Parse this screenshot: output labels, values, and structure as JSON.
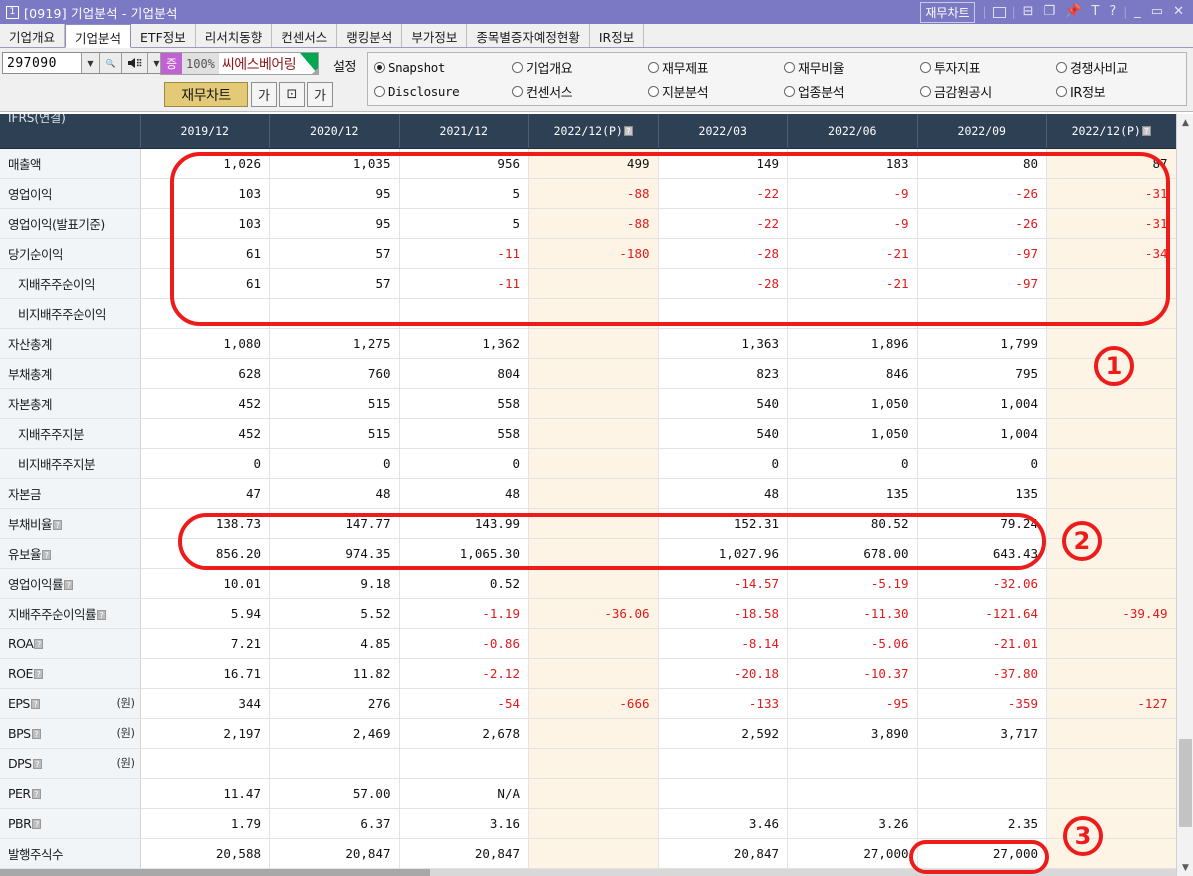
{
  "titlebar": {
    "window_number": "1",
    "title": "[0919] 기업분석 - 기업분석",
    "chart_button": "재무차트",
    "icons": [
      "line-chart-icon",
      "restore-icon",
      "cascade-icon",
      "pin-icon",
      "text-icon",
      "help-icon"
    ],
    "minimize": "_",
    "maximize": "▭",
    "close": "✕",
    "bg_color": "#7b79c4"
  },
  "tabs": [
    {
      "label": "기업개요",
      "active": false
    },
    {
      "label": "기업분석",
      "active": true
    },
    {
      "label": "ETF정보",
      "active": false
    },
    {
      "label": "리서치동향",
      "active": false
    },
    {
      "label": "컨센서스",
      "active": false
    },
    {
      "label": "랭킹분석",
      "active": false
    },
    {
      "label": "부가정보",
      "active": false
    },
    {
      "label": "종목별증자예정현황",
      "active": false
    },
    {
      "label": "IR정보",
      "active": false
    }
  ],
  "toolbar": {
    "code_value": "297090",
    "code_placeholder": "종목코드",
    "dropdown_icon": "chevron-down-icon",
    "search_icon": "search-icon",
    "speaker_icon": "speaker-icon",
    "stock_badge": "증",
    "stock_percent": "100%",
    "stock_name": "씨에스베어링",
    "setting_label": "설정",
    "chart_button": "재무차트",
    "font_small_button": "가",
    "fit_button": "⊡",
    "font_large_button": "가",
    "badge_color": "#c062d2",
    "name_color": "#8b1a1a",
    "chart_button_color": "#e3ca76"
  },
  "radios": {
    "row1": [
      {
        "label": "Snapshot",
        "selected": true,
        "mono": true
      },
      {
        "label": "기업개요",
        "selected": false,
        "mono": false
      },
      {
        "label": "재무제표",
        "selected": false,
        "mono": false
      },
      {
        "label": "재무비율",
        "selected": false,
        "mono": false
      },
      {
        "label": "투자지표",
        "selected": false,
        "mono": false
      },
      {
        "label": "경쟁사비교",
        "selected": false,
        "mono": false
      }
    ],
    "row2": [
      {
        "label": "Disclosure",
        "selected": false,
        "mono": true
      },
      {
        "label": "컨센서스",
        "selected": false,
        "mono": false
      },
      {
        "label": "지분분석",
        "selected": false,
        "mono": false
      },
      {
        "label": "업종분석",
        "selected": false,
        "mono": false
      },
      {
        "label": "금감원공시",
        "selected": false,
        "mono": false
      },
      {
        "label": "IR정보",
        "selected": false,
        "mono": false
      }
    ]
  },
  "table": {
    "corner_label": "IFRS(연결)",
    "columns": [
      {
        "label": "2019/12",
        "estimate": false
      },
      {
        "label": "2020/12",
        "estimate": false
      },
      {
        "label": "2021/12",
        "estimate": false
      },
      {
        "label": "2022/12(P)",
        "estimate": true
      },
      {
        "label": "2022/03",
        "estimate": false
      },
      {
        "label": "2022/06",
        "estimate": false
      },
      {
        "label": "2022/09",
        "estimate": false
      },
      {
        "label": "2022/12(P)",
        "estimate": true
      }
    ],
    "rows": [
      {
        "label": "매출액",
        "indent": false,
        "help": false,
        "unit": "",
        "values": [
          "1,026",
          "1,035",
          "956",
          "499",
          "149",
          "183",
          "80",
          "87"
        ]
      },
      {
        "label": "영업이익",
        "indent": false,
        "help": false,
        "unit": "",
        "values": [
          "103",
          "95",
          "5",
          "-88",
          "-22",
          "-9",
          "-26",
          "-31"
        ]
      },
      {
        "label": "영업이익(발표기준)",
        "indent": false,
        "help": false,
        "unit": "",
        "values": [
          "103",
          "95",
          "5",
          "-88",
          "-22",
          "-9",
          "-26",
          "-31"
        ]
      },
      {
        "label": "당기순이익",
        "indent": false,
        "help": false,
        "unit": "",
        "values": [
          "61",
          "57",
          "-11",
          "-180",
          "-28",
          "-21",
          "-97",
          "-34"
        ]
      },
      {
        "label": "지배주주순이익",
        "indent": true,
        "help": false,
        "unit": "",
        "values": [
          "61",
          "57",
          "-11",
          "",
          "-28",
          "-21",
          "-97",
          ""
        ]
      },
      {
        "label": "비지배주주순이익",
        "indent": true,
        "help": false,
        "unit": "",
        "values": [
          "",
          "",
          "",
          "",
          "",
          "",
          "",
          ""
        ]
      },
      {
        "label": "자산총계",
        "indent": false,
        "help": false,
        "unit": "",
        "values": [
          "1,080",
          "1,275",
          "1,362",
          "",
          "1,363",
          "1,896",
          "1,799",
          ""
        ]
      },
      {
        "label": "부채총계",
        "indent": false,
        "help": false,
        "unit": "",
        "values": [
          "628",
          "760",
          "804",
          "",
          "823",
          "846",
          "795",
          ""
        ]
      },
      {
        "label": "자본총계",
        "indent": false,
        "help": false,
        "unit": "",
        "values": [
          "452",
          "515",
          "558",
          "",
          "540",
          "1,050",
          "1,004",
          ""
        ]
      },
      {
        "label": "지배주주지분",
        "indent": true,
        "help": false,
        "unit": "",
        "values": [
          "452",
          "515",
          "558",
          "",
          "540",
          "1,050",
          "1,004",
          ""
        ]
      },
      {
        "label": "비지배주주지분",
        "indent": true,
        "help": false,
        "unit": "",
        "values": [
          "0",
          "0",
          "0",
          "",
          "0",
          "0",
          "0",
          ""
        ]
      },
      {
        "label": "자본금",
        "indent": false,
        "help": false,
        "unit": "",
        "values": [
          "47",
          "48",
          "48",
          "",
          "48",
          "135",
          "135",
          ""
        ]
      },
      {
        "label": "부채비율",
        "indent": false,
        "help": true,
        "unit": "",
        "values": [
          "138.73",
          "147.77",
          "143.99",
          "",
          "152.31",
          "80.52",
          "79.24",
          ""
        ]
      },
      {
        "label": "유보율",
        "indent": false,
        "help": true,
        "unit": "",
        "values": [
          "856.20",
          "974.35",
          "1,065.30",
          "",
          "1,027.96",
          "678.00",
          "643.43",
          ""
        ]
      },
      {
        "label": "영업이익률",
        "indent": false,
        "help": true,
        "unit": "",
        "values": [
          "10.01",
          "9.18",
          "0.52",
          "",
          "-14.57",
          "-5.19",
          "-32.06",
          ""
        ]
      },
      {
        "label": "지배주주순이익률",
        "indent": false,
        "help": true,
        "unit": "",
        "values": [
          "5.94",
          "5.52",
          "-1.19",
          "-36.06",
          "-18.58",
          "-11.30",
          "-121.64",
          "-39.49"
        ]
      },
      {
        "label": "ROA",
        "indent": false,
        "help": true,
        "unit": "",
        "values": [
          "7.21",
          "4.85",
          "-0.86",
          "",
          "-8.14",
          "-5.06",
          "-21.01",
          ""
        ]
      },
      {
        "label": "ROE",
        "indent": false,
        "help": true,
        "unit": "",
        "values": [
          "16.71",
          "11.82",
          "-2.12",
          "",
          "-20.18",
          "-10.37",
          "-37.80",
          ""
        ]
      },
      {
        "label": "EPS",
        "indent": false,
        "help": true,
        "unit": "(원)",
        "values": [
          "344",
          "276",
          "-54",
          "-666",
          "-133",
          "-95",
          "-359",
          "-127"
        ]
      },
      {
        "label": "BPS",
        "indent": false,
        "help": true,
        "unit": "(원)",
        "values": [
          "2,197",
          "2,469",
          "2,678",
          "",
          "2,592",
          "3,890",
          "3,717",
          ""
        ]
      },
      {
        "label": "DPS",
        "indent": false,
        "help": true,
        "unit": "(원)",
        "values": [
          "",
          "",
          "",
          "",
          "",
          "",
          "",
          ""
        ]
      },
      {
        "label": "PER",
        "indent": false,
        "help": true,
        "unit": "",
        "values": [
          "11.47",
          "57.00",
          "N/A",
          "",
          "",
          "",
          "",
          ""
        ]
      },
      {
        "label": "PBR",
        "indent": false,
        "help": true,
        "unit": "",
        "values": [
          "1.79",
          "6.37",
          "3.16",
          "",
          "3.46",
          "3.26",
          "2.35",
          ""
        ]
      },
      {
        "label": "발행주식수",
        "indent": false,
        "help": false,
        "unit": "",
        "values": [
          "20,588",
          "20,847",
          "20,847",
          "",
          "20,847",
          "27,000",
          "27,000",
          ""
        ]
      }
    ],
    "header_bg": "#2e4053",
    "estimate_bg": "#fdf4e6",
    "negative_color": "#e01b1b"
  },
  "annotations": [
    {
      "id": "1",
      "label": "①"
    },
    {
      "id": "2",
      "label": "②"
    },
    {
      "id": "3",
      "label": "③"
    }
  ],
  "scrollbar": {
    "up_arrow": "chevron-up-icon",
    "down_arrow": "chevron-down-icon"
  }
}
